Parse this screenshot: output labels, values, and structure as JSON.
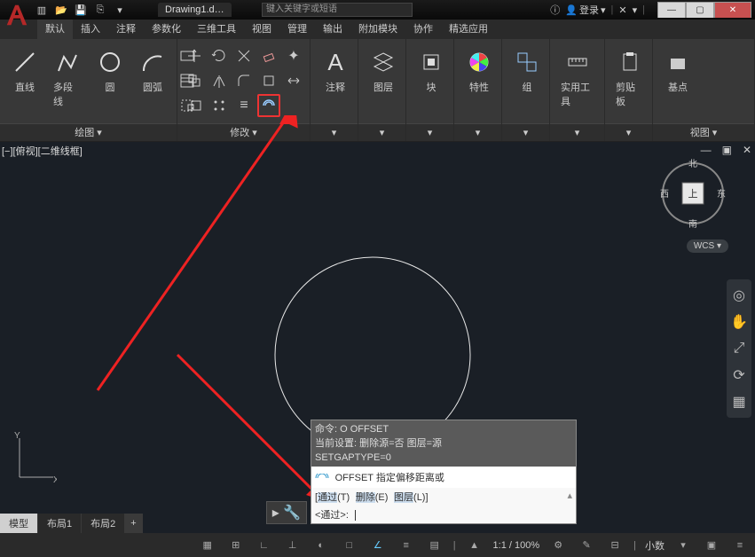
{
  "title_tab": "Drawing1.d…",
  "search_placeholder": "键入关键字或短语",
  "user_label": "登录",
  "tabs": [
    "默认",
    "插入",
    "注释",
    "参数化",
    "三维工具",
    "视图",
    "管理",
    "输出",
    "附加模块",
    "协作",
    "精选应用"
  ],
  "panels": {
    "draw_title": "绘图 ▾",
    "modify_title": "修改 ▾",
    "annotate": "注释",
    "layer": "图层",
    "block": "块",
    "props": "特性",
    "group": "组",
    "util": "实用工具",
    "clip": "剪贴板",
    "view": "视图 ▾",
    "base": "基点"
  },
  "draw_big": {
    "line": "直线",
    "pline": "多段线",
    "circle": "圆",
    "arc": "圆弧"
  },
  "viewport_label": "[−][俯视][二维线框]",
  "wcs": "WCS ▾",
  "cube": {
    "n": "北",
    "s": "南",
    "e": "东",
    "w": "西",
    "top": "上"
  },
  "cmd": {
    "hist1": "命令: O  OFFSET",
    "hist2": "当前设置: 删除源=否  图层=源",
    "hist3": "  SETGAPTYPE=0",
    "p_label": "OFFSET 指定偏移距离或",
    "opts_open": "[",
    "t": "通过",
    "tk": "(T)",
    "e": "删除",
    "ek": "(E)",
    "l": "图层",
    "lk": "(L)",
    "opts_close": "]",
    "prompt": "<通过>:"
  },
  "layout": {
    "model": "模型",
    "l1": "布局1",
    "l2": "布局2"
  },
  "status": {
    "ratio": "1:1 / 100%",
    "mode": "小数"
  }
}
